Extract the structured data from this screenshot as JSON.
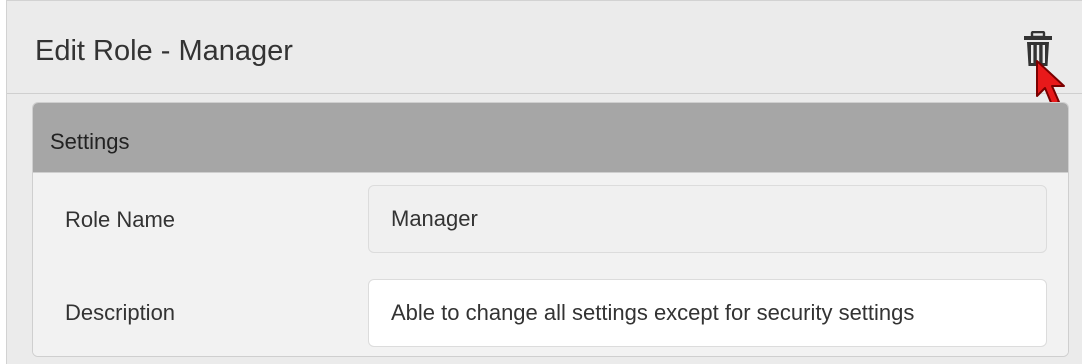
{
  "dialog": {
    "title": "Edit Role - Manager",
    "delete_icon": "trash-icon"
  },
  "settings": {
    "section_title": "Settings",
    "role_name": {
      "label": "Role Name",
      "value": "Manager"
    },
    "description": {
      "label": "Description",
      "value": "Able to change all settings except for security settings"
    }
  },
  "colors": {
    "header_bg": "#ebebeb",
    "panel_header_bg": "#a6a6a6",
    "panel_body_bg": "#f2f2f2",
    "cursor_red": "#e8191a"
  }
}
